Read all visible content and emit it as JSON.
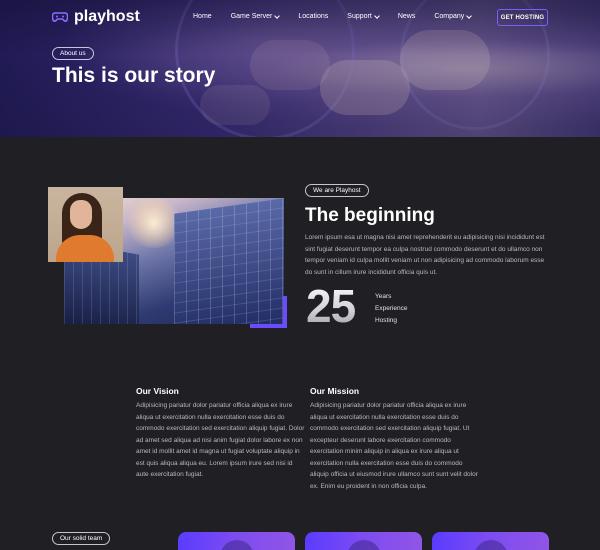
{
  "brand": {
    "name": "playhost",
    "accent": "#6a4cff"
  },
  "nav": {
    "items": [
      {
        "label": "Home",
        "dropdown": false
      },
      {
        "label": "Game Server",
        "dropdown": true
      },
      {
        "label": "Locations",
        "dropdown": false
      },
      {
        "label": "Support",
        "dropdown": true
      },
      {
        "label": "News",
        "dropdown": false
      },
      {
        "label": "Company",
        "dropdown": true
      }
    ],
    "cta_label": "GET HOSTING"
  },
  "hero": {
    "tag": "About us",
    "title": "This is our story"
  },
  "about": {
    "tag": "We are Playhost",
    "title": "The beginning",
    "paragraph": "Lorem ipsum esa ut magna nisi amet reprehenderit eu adipisicing nisi incididunt est sint fugiat deserunt tempor ea culpa nostrud commodo deserunt et do ullamco non tempor veniam id culpa mollit veniam ut non adipisicing ad commodo laborum esse do sunt in cillum irure incididunt officia quis ut.",
    "stat_value": "25",
    "stat_lines": [
      "Years",
      "Experience",
      "Hosting"
    ]
  },
  "vision": {
    "title": "Our Vision",
    "text": "Adipisicing pariatur dolor pariatur officia aliqua ex irure aliqua ut exercitation nulla exercitation esse duis do commodo exercitation sed exercitation aliquip fugiat. Dolor ad amet sed aliqua ad nisi anim fugiat dolor labore ex non amet id mollit amet id magna ut fugiat voluptate aliquip in est quis aliqua aliqua eu. Lorem ipsum irure sed nisi id aute exercitation fugiat."
  },
  "mission": {
    "title": "Our Mission",
    "text": "Adipisicing pariatur dolor pariatur officia aliqua ex irure aliqua ut exercitation nulla exercitation esse duis do commodo exercitation sed exercitation aliquip fugiat. Ut excepteur deserunt labore exercitation commodo exercitation minim aliquip in aliqua ex irure aliqua ut exercitation nulla exercitation esse duis do commodo aliquip officia ut eiusmod irure ullamco sunt sunt velit dolor ex. Enim eu proident in non officia culpa."
  },
  "team": {
    "tag": "Our solid team"
  }
}
